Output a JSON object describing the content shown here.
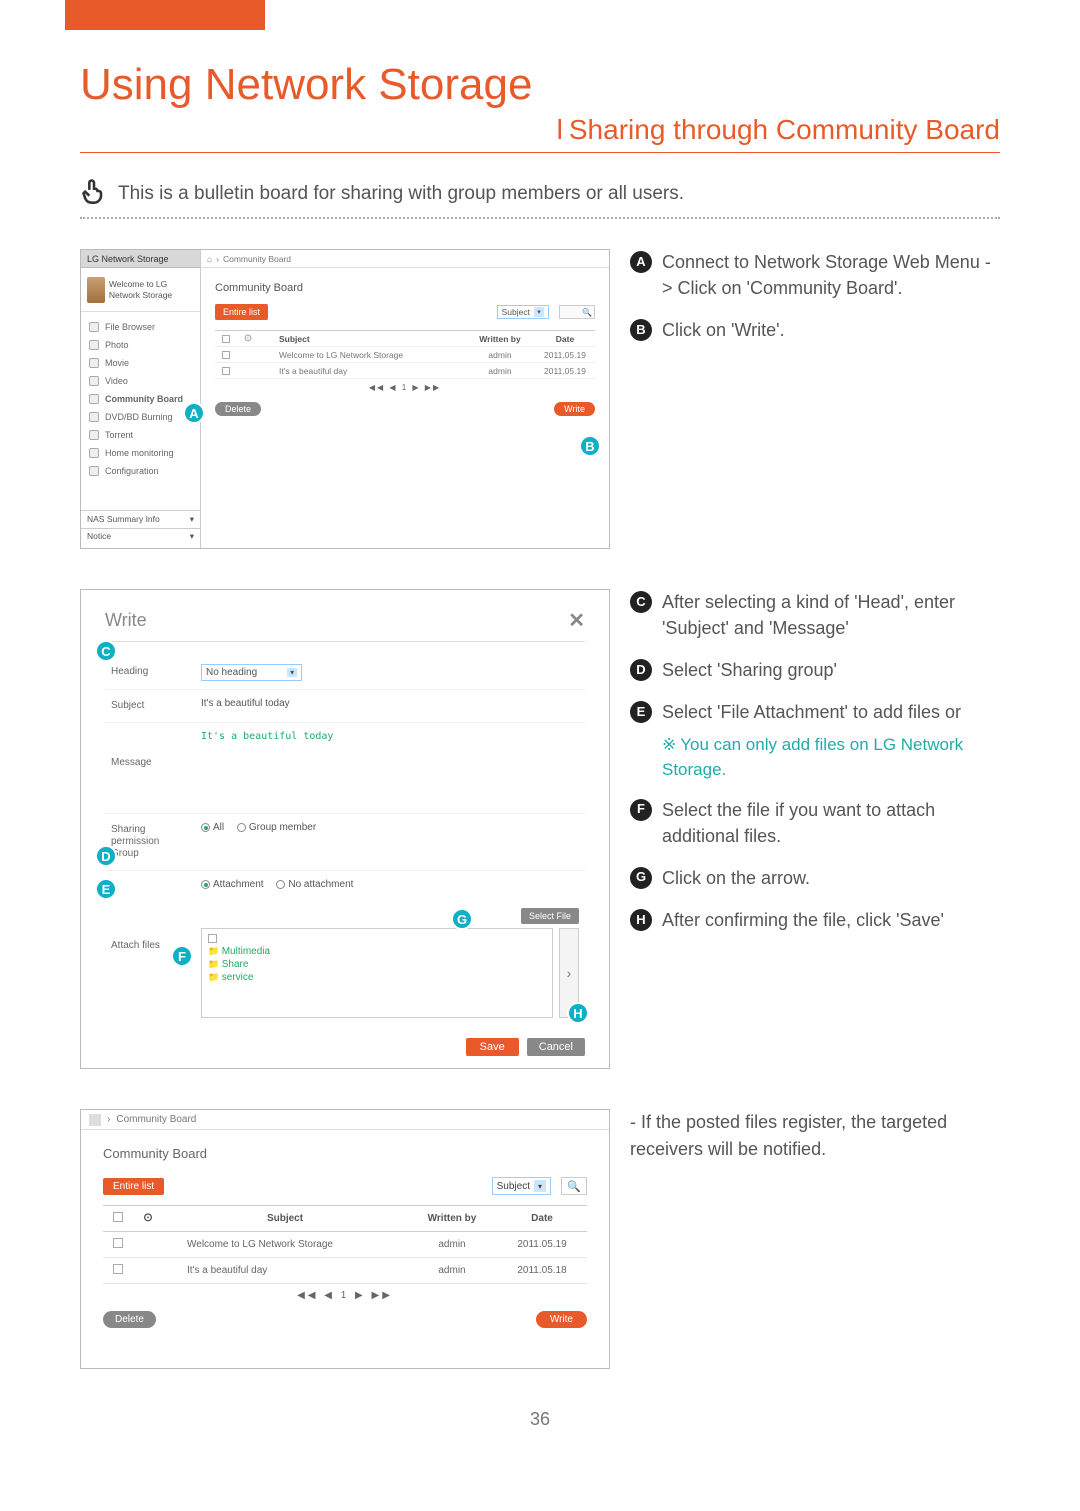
{
  "domain": "Document",
  "page_number": "36",
  "header": {
    "title": "Using Network Storage",
    "subtitle": "Sharing through Community Board"
  },
  "intro": "This is a bulletin board for sharing with group members or all users.",
  "steps1": {
    "A": "Connect to Network Storage Web Menu -> Click on 'Community Board'.",
    "B": "Click on 'Write'."
  },
  "steps2": {
    "C": "After selecting a kind of 'Head', enter 'Subject' and 'Message'",
    "D": "Select 'Sharing group'",
    "E": "Select 'File Attachment' to add files or",
    "E_note": "You can only add files on LG Network Storage.",
    "F": "Select the file if you want to attach additional files.",
    "G": "Click on the arrow.",
    "H": "After confirming the file, click 'Save'"
  },
  "steps3_plain": "- If the posted files register, the targeted receivers will be notified.",
  "shot1": {
    "logo": "LG Network Storage",
    "welcome": "Welcome to LG Network Storage",
    "menu": [
      "File Browser",
      "Photo",
      "Movie",
      "Video",
      "Community Board",
      "DVD/BD Burning",
      "Torrent",
      "Home monitoring",
      "Configuration"
    ],
    "info_bar": "NAS Summary Info",
    "notice_bar": "Notice",
    "breadcrumb_sep": "›",
    "breadcrumb": "Community Board",
    "heading": "Community Board",
    "entire": "Entire list",
    "filter": "Subject",
    "cols": {
      "subject": "Subject",
      "written": "Written by",
      "date": "Date"
    },
    "rows": [
      {
        "subject": "Welcome to LG Network Storage",
        "written": "admin",
        "date": "2011.05.19"
      },
      {
        "subject": "It's a beautiful day",
        "written": "admin",
        "date": "2011.05.19"
      }
    ],
    "pager": "◀◀ ◀ 1 ▶ ▶▶",
    "delete": "Delete",
    "write": "Write"
  },
  "shot2": {
    "title": "Write",
    "close": "✕",
    "labels": {
      "heading": "Heading",
      "subject": "Subject",
      "message": "Message",
      "sharing": "Sharing permission Group",
      "attach": "Attach files"
    },
    "values": {
      "heading": "No heading",
      "subject": "It's a beautiful today",
      "message": "It's a beautiful today"
    },
    "sharing_opts": {
      "all": "All",
      "group": "Group member"
    },
    "attach_opts": {
      "attach": "Attachment",
      "no": "No attachment"
    },
    "select_file": "Select File",
    "tree": [
      "Multimedia",
      "Share",
      "service"
    ],
    "save": "Save",
    "cancel": "Cancel"
  },
  "shot3": {
    "breadcrumb": "Community Board",
    "heading": "Community Board",
    "entire": "Entire list",
    "filter": "Subject",
    "cols": {
      "subject": "Subject",
      "written": "Written by",
      "date": "Date"
    },
    "rows": [
      {
        "subject": "Welcome to LG Network Storage",
        "written": "admin",
        "date": "2011.05.19"
      },
      {
        "subject": "It's a beautiful day",
        "written": "admin",
        "date": "2011.05.18"
      }
    ],
    "pager": "◀◀ ◀ 1 ▶ ▶▶",
    "delete": "Delete",
    "write": "Write"
  }
}
